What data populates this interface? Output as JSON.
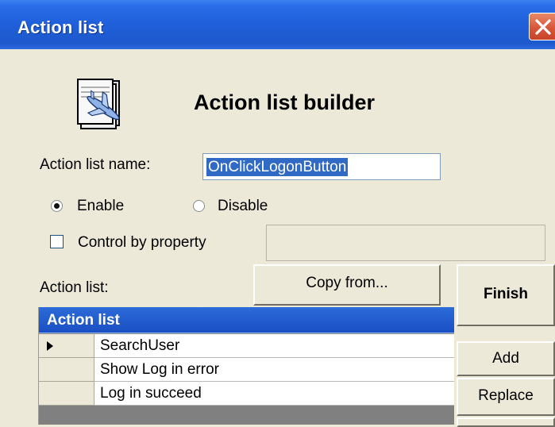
{
  "window": {
    "title": "Action list",
    "close_icon": "close-icon"
  },
  "header": {
    "icon": "airplane-document-icon",
    "heading": "Action list builder"
  },
  "form": {
    "name_label": "Action list name:",
    "name_value": "OnClickLogonButton",
    "enable_label": "Enable",
    "disable_label": "Disable",
    "enabled_selected": true,
    "control_by_property_label": "Control by property",
    "control_by_property_checked": false,
    "property_value": ""
  },
  "action_list": {
    "label": "Action list:",
    "copy_from_label": "Copy from...",
    "column_header": "Action list",
    "current_row_icon": "row-pointer-icon",
    "rows": [
      {
        "name": "SearchUser",
        "current": true
      },
      {
        "name": "Show Log in error",
        "current": false
      },
      {
        "name": "Log in succeed",
        "current": false
      }
    ]
  },
  "buttons": {
    "finish": "Finish",
    "add": "Add",
    "replace": "Replace"
  },
  "colors": {
    "titlebar": "#1f5fd9",
    "dialog_bg": "#ece9d8",
    "selection": "#316ac5",
    "close_button": "#d8573a"
  }
}
